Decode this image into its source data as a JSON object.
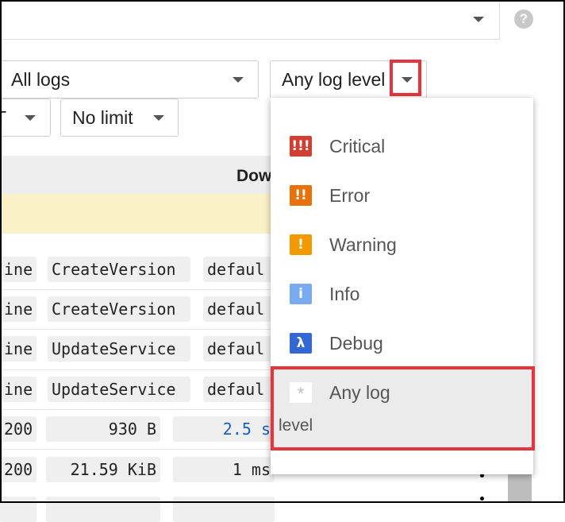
{
  "header": {
    "help_icon": "?"
  },
  "filters": {
    "log_source": "All logs",
    "log_level": "Any log level",
    "timezone_partial": "T",
    "limit": "No limit"
  },
  "table": {
    "header_partial": "Dow",
    "rows": [
      {
        "c1": "ine",
        "c2": "CreateVersion",
        "c3": "defaul"
      },
      {
        "c1": "ine",
        "c2": "CreateVersion",
        "c3": "defaul"
      },
      {
        "c1": "ine",
        "c2": "UpdateService",
        "c3": "defaul"
      },
      {
        "c1": "ine",
        "c2": "UpdateService",
        "c3": "defaul"
      },
      {
        "c1": "200",
        "c2": "930 B",
        "c3": "2.5 s"
      },
      {
        "c1": "200",
        "c2": "21.59 KiB",
        "c3": "1 ms"
      }
    ]
  },
  "menu": {
    "items": [
      {
        "icon": "!!!",
        "label": "Critical",
        "color": "#d23f31"
      },
      {
        "icon": "!!",
        "label": "Error",
        "color": "#e8710a"
      },
      {
        "icon": "!",
        "label": "Warning",
        "color": "#f29900"
      },
      {
        "icon": "i",
        "label": "Info",
        "color": "#7aaaf0"
      },
      {
        "icon": "λ",
        "label": "Debug",
        "color": "#3367d6"
      }
    ],
    "any": {
      "icon": "*",
      "label_line1": "Any log",
      "label_line2": "level"
    }
  },
  "colors": {
    "highlight": "#e8323c",
    "link": "#1a5ccc",
    "warning_row": "#fbf1c7"
  }
}
